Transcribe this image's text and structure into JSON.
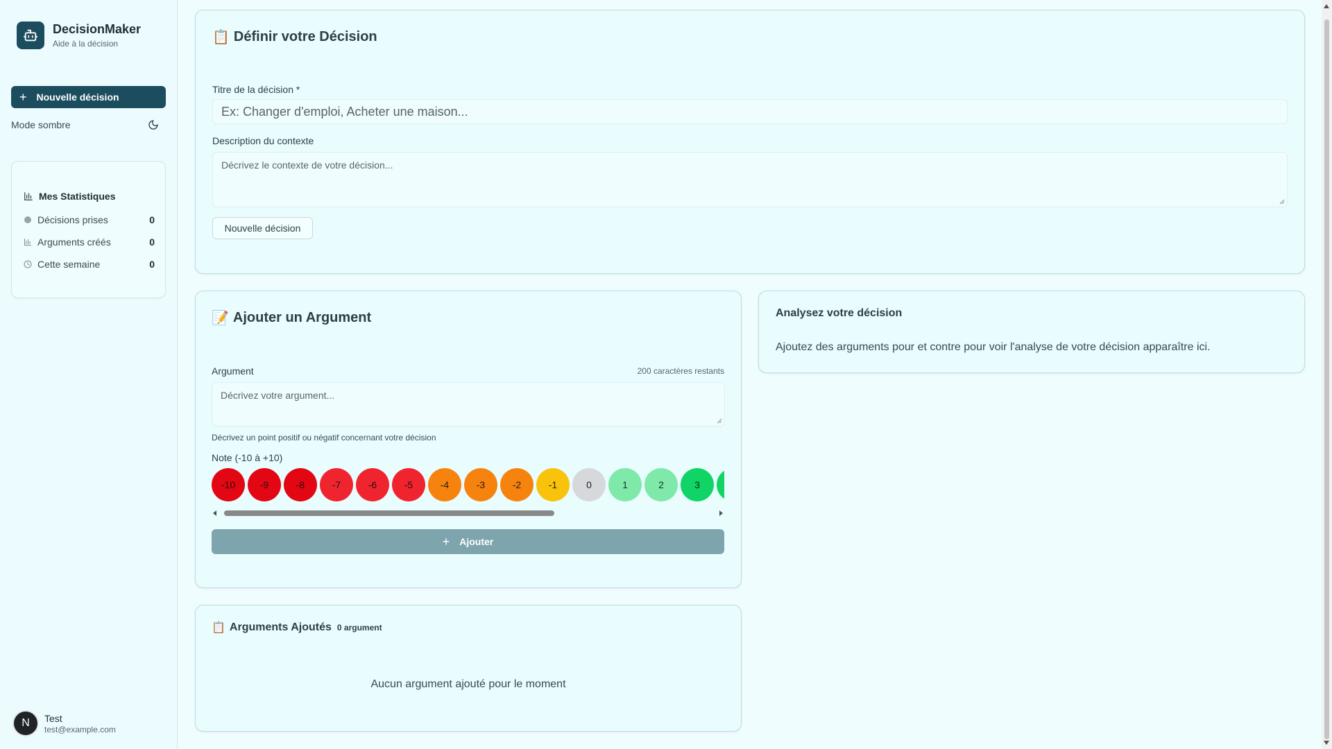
{
  "sidebar": {
    "brand_name": "DecisionMaker",
    "brand_subtitle": "Aide à la décision",
    "new_decision_label": "Nouvelle décision",
    "dark_mode_label": "Mode sombre",
    "stats": {
      "title": "Mes Statistiques",
      "items": [
        {
          "label": "Décisions prises",
          "value": "0",
          "icon": "circle-icon"
        },
        {
          "label": "Arguments créés",
          "value": "0",
          "icon": "bar-chart-icon"
        },
        {
          "label": "Cette semaine",
          "value": "0",
          "icon": "clock-icon"
        }
      ]
    },
    "user": {
      "initial": "N",
      "name": "Test",
      "email": "test@example.com"
    }
  },
  "define_card": {
    "emoji": "📋",
    "title": "Définir votre Décision",
    "title_label": "Titre de la décision *",
    "title_placeholder": "Ex: Changer d'emploi, Acheter une maison...",
    "description_label": "Description du contexte",
    "description_placeholder": "Décrivez le contexte de votre décision...",
    "new_decision_button": "Nouvelle décision"
  },
  "argument_card": {
    "emoji": "📝",
    "title": "Ajouter un Argument",
    "argument_label": "Argument",
    "chars_remaining": "200 caractères restants",
    "argument_placeholder": "Décrivez votre argument...",
    "helper_text": "Décrivez un point positif ou négatif concernant votre décision",
    "score_label": "Note (-10 à +10)",
    "scores": [
      "-10",
      "-9",
      "-8",
      "-7",
      "-6",
      "-5",
      "-4",
      "-3",
      "-2",
      "-1",
      "0",
      "1",
      "2",
      "3"
    ],
    "add_button": "Ajouter"
  },
  "added_card": {
    "emoji": "📋",
    "title": "Arguments Ajoutés",
    "count_label": "0 argument",
    "empty_text": "Aucun argument ajouté pour le moment"
  },
  "analysis_card": {
    "title": "Analysez votre décision",
    "body": "Ajoutez des arguments pour et contre pour voir l'analyse de votre décision apparaître ici."
  },
  "colors": {
    "primary": "#1c4d5e",
    "score_strong_negative": "#e30613",
    "score_negative": "#f0242f",
    "score_warning": "#f7830f",
    "score_slight_negative": "#f8c30a",
    "score_neutral": "#d6d8dc",
    "score_slight_positive": "#7ee9a8",
    "score_positive": "#10d465"
  }
}
